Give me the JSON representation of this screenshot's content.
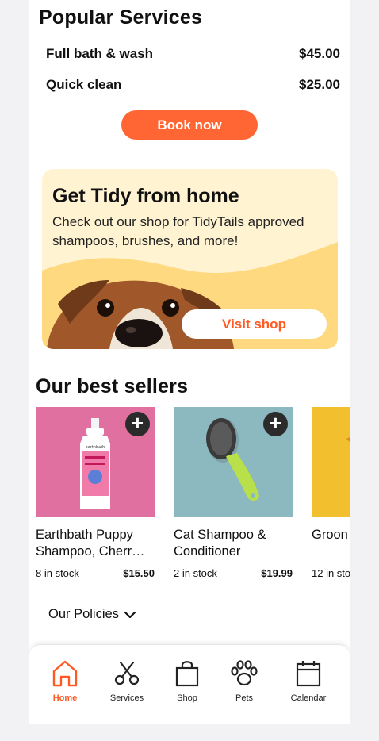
{
  "services": {
    "title": "Popular Services",
    "items": [
      {
        "name": "Full bath & wash",
        "price": "$45.00"
      },
      {
        "name": "Quick clean",
        "price": "$25.00"
      }
    ],
    "book_label": "Book now"
  },
  "promo": {
    "title": "Get Tidy from home",
    "body": "Check out our shop for TidyTails approved shampoos, brushes, and more!",
    "button_label": "Visit shop"
  },
  "best_sellers": {
    "title": "Our best sellers",
    "products": [
      {
        "name_line1": "Earthbath Puppy",
        "name_line2": "Shampoo, Cherr…",
        "stock": "8 in stock",
        "price": "$15.50",
        "image_color": "#e0709f"
      },
      {
        "name_line1": "Cat Shampoo &",
        "name_line2": "Conditioner",
        "stock": "2 in stock",
        "price": "$19.99",
        "image_color": "#8cb8bf"
      },
      {
        "name_line1": "Groon",
        "name_line2": "",
        "stock": "12 in sto",
        "price": "",
        "image_color": "#f2c02f"
      }
    ],
    "bottle_label": "earthbath"
  },
  "policies": {
    "label": "Our Policies"
  },
  "tabs": [
    {
      "label": "Home",
      "icon": "home-icon",
      "active": true
    },
    {
      "label": "Services",
      "icon": "scissors-icon",
      "active": false
    },
    {
      "label": "Shop",
      "icon": "shopping-bag-icon",
      "active": false
    },
    {
      "label": "Pets",
      "icon": "paw-icon",
      "active": false
    },
    {
      "label": "Calendar",
      "icon": "calendar-icon",
      "active": false
    }
  ],
  "colors": {
    "accent": "#ff6633",
    "promo_bg": "#fff3d2",
    "promo_wave": "#ffd97f"
  }
}
